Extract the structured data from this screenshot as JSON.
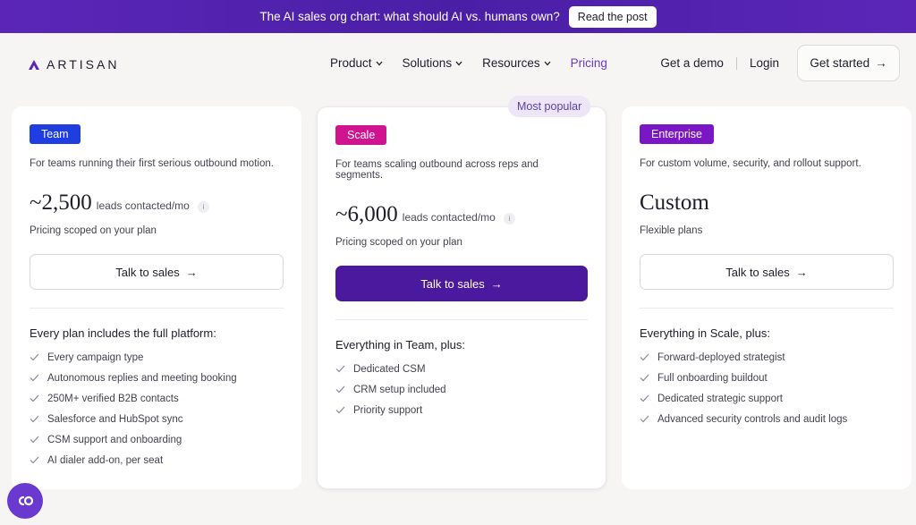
{
  "announcement": {
    "text": "The AI sales org chart: what should AI vs. humans own?",
    "button": "Read the post"
  },
  "nav": {
    "logo": "ARTISAN",
    "menu": [
      {
        "label": "Product",
        "has_dropdown": true
      },
      {
        "label": "Solutions",
        "has_dropdown": true
      },
      {
        "label": "Resources",
        "has_dropdown": true
      },
      {
        "label": "Pricing",
        "has_dropdown": false,
        "active": true
      }
    ],
    "get_demo": "Get a demo",
    "login": "Login",
    "get_started": "Get started"
  },
  "popular_badge": "Most popular",
  "plans": [
    {
      "badge": "Team",
      "description": "For teams running their first serious outbound motion.",
      "metric": "~2,500",
      "unit": "leads contacted/mo",
      "sub": "Pricing scoped on your plan",
      "cta": "Talk to sales",
      "features_title": "Every plan includes the full platform:",
      "features": [
        "Every campaign type",
        "Autonomous replies and meeting booking",
        "250M+ verified B2B contacts",
        "Salesforce and HubSpot sync",
        "CSM support and onboarding",
        "AI dialer add-on, per seat"
      ]
    },
    {
      "badge": "Scale",
      "description": "For teams scaling outbound across reps and segments.",
      "metric": "~6,000",
      "unit": "leads contacted/mo",
      "sub": "Pricing scoped on your plan",
      "cta": "Talk to sales",
      "features_title": "Everything in Team, plus:",
      "features": [
        "Dedicated CSM",
        "CRM setup included",
        "Priority support"
      ]
    },
    {
      "badge": "Enterprise",
      "description": "For custom volume, security, and rollout support.",
      "metric": "Custom",
      "unit": "",
      "sub": "Flexible plans",
      "cta": "Talk to sales",
      "features_title": "Everything in Scale, plus:",
      "features": [
        "Forward-deployed strategist",
        "Full onboarding buildout",
        "Dedicated strategic support",
        "Advanced security controls and audit logs"
      ]
    }
  ],
  "colors": {
    "accent": "#6a3ad0",
    "announce_bg": "#4a1fa6",
    "team_badge": "#1f3ee0",
    "scale_badge": "#d0138f",
    "enterprise_badge": "#7a16c6",
    "primary_cta": "#4a199e"
  },
  "icons": {
    "chat": "chat-bubble-icon",
    "check": "check-icon",
    "arrow": "arrow-right-icon",
    "info": "info-icon"
  }
}
